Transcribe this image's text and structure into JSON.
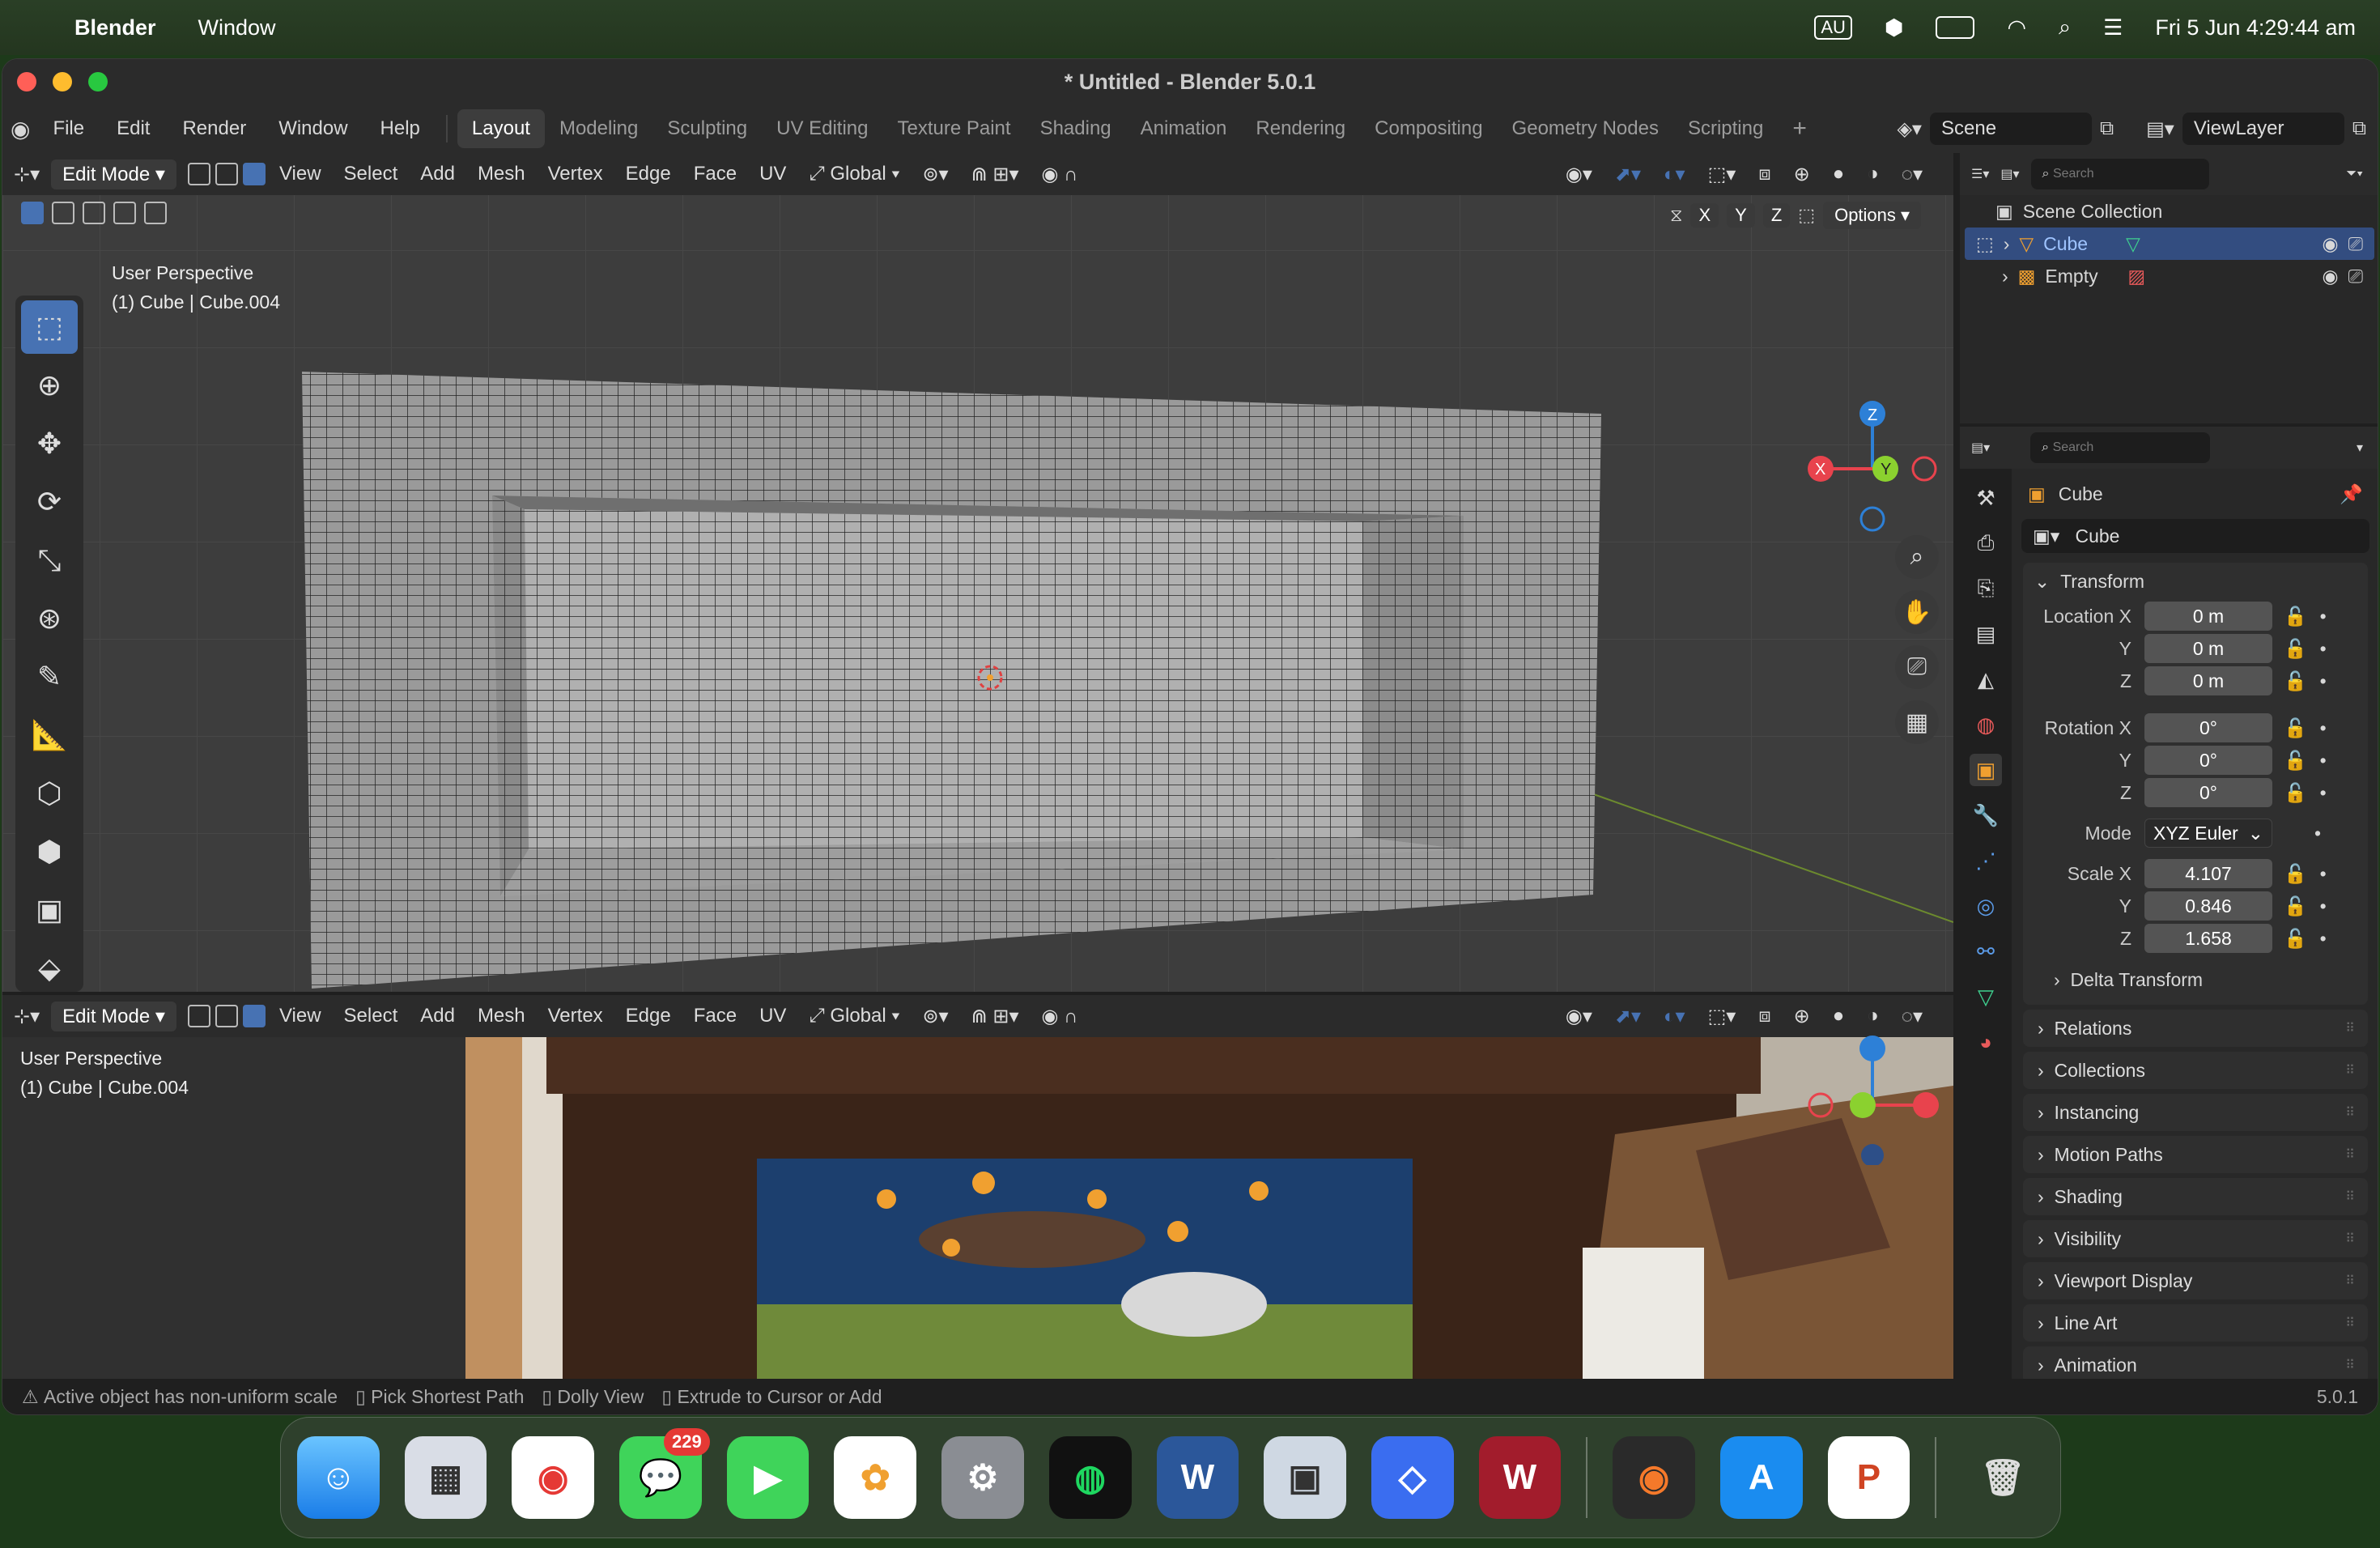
{
  "menubar": {
    "app_name": "Blender",
    "menu_window": "Window",
    "input_source": "AU",
    "datetime": "Fri 5 Jun  4:29:44 am"
  },
  "window": {
    "title": "* Untitled - Blender 5.0.1",
    "menus": [
      "File",
      "Edit",
      "Render",
      "Window",
      "Help"
    ],
    "workspaces": [
      "Layout",
      "Modeling",
      "Sculpting",
      "UV Editing",
      "Texture Paint",
      "Shading",
      "Animation",
      "Rendering",
      "Compositing",
      "Geometry Nodes",
      "Scripting"
    ],
    "active_workspace": "Layout",
    "scene": "Scene",
    "view_layer": "ViewLayer"
  },
  "viewport_header": {
    "mode": "Edit Mode",
    "menus": [
      "View",
      "Select",
      "Add",
      "Mesh",
      "Vertex",
      "Edge",
      "Face",
      "UV"
    ],
    "orientation": "Global",
    "axes": [
      "X",
      "Y",
      "Z"
    ],
    "options": "Options"
  },
  "viewport_top": {
    "perspective": "User Perspective",
    "object_info": "(1) Cube | Cube.004"
  },
  "viewport_bottom": {
    "perspective": "User Perspective",
    "object_info": "(1) Cube | Cube.004"
  },
  "gizmo": {
    "x": "X",
    "y": "Y",
    "z": "Z"
  },
  "outliner": {
    "search_placeholder": "Search",
    "root": "Scene Collection",
    "items": [
      "Cube",
      "Empty"
    ]
  },
  "properties": {
    "search_placeholder": "Search",
    "object_name": "Cube",
    "mesh_name": "Cube",
    "transform_title": "Transform",
    "location": {
      "label": "Location X",
      "x": "0 m",
      "y": "0 m",
      "z": "0 m"
    },
    "rotation": {
      "label": "Rotation X",
      "x": "0°",
      "y": "0°",
      "z": "0°"
    },
    "mode_label": "Mode",
    "mode_value": "XYZ Euler",
    "scale": {
      "label": "Scale X",
      "x": "4.107",
      "y": "0.846",
      "z": "1.658"
    },
    "axis_y": "Y",
    "axis_z": "Z",
    "delta_transform": "Delta Transform",
    "panels": [
      "Relations",
      "Collections",
      "Instancing",
      "Motion Paths",
      "Shading",
      "Visibility",
      "Viewport Display",
      "Line Art",
      "Animation"
    ]
  },
  "statusbar": {
    "warning": "Active object has non-uniform scale",
    "hint1": "Pick Shortest Path",
    "hint2": "Dolly View",
    "hint3": "Extrude to Cursor or Add",
    "version": "5.0.1"
  },
  "dock": {
    "messages_badge": "229",
    "apps": [
      "Finder",
      "Launchpad",
      "Chrome",
      "Messages",
      "FaceTime",
      "Photos",
      "System Settings",
      "Spotify",
      "Word",
      "Preview",
      "Roblox",
      "WebAssign",
      "Blender",
      "App Store",
      "PowerPoint",
      "Trash"
    ]
  },
  "colors": {
    "accent": "#4772b3",
    "x_axis": "#e8434d",
    "y_axis": "#8bd12f",
    "z_axis": "#2d80d7"
  }
}
